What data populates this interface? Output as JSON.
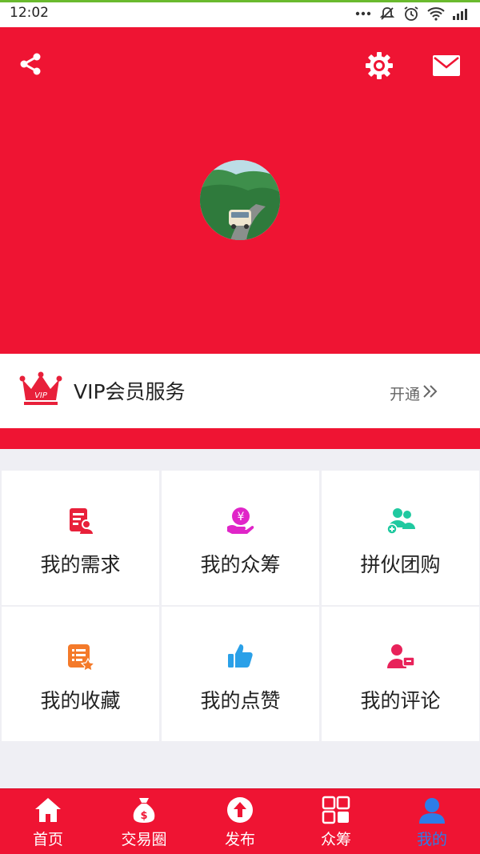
{
  "status_bar": {
    "time": "12:02",
    "icons": [
      "more-dots-icon",
      "mute-icon",
      "alarm-icon",
      "wifi-icon",
      "signal-icon"
    ]
  },
  "header": {
    "background_color": "#ef1433",
    "icons": [
      "share-icon",
      "settings-gear-icon",
      "mail-icon"
    ]
  },
  "vip": {
    "title": "VIP会员服务",
    "crown_text": "VIP",
    "action_label": "开通"
  },
  "menu": [
    {
      "label": "我的需求",
      "icon": "demand-doc-icon",
      "color": "#e8203a"
    },
    {
      "label": "我的众筹",
      "icon": "crowdfund-yen-icon",
      "color": "#e025c8"
    },
    {
      "label": "拼伙团购",
      "icon": "group-people-icon",
      "color": "#20c9a0"
    },
    {
      "label": "我的收藏",
      "icon": "favorites-list-icon",
      "color": "#f47a2a"
    },
    {
      "label": "我的点赞",
      "icon": "thumbs-up-icon",
      "color": "#2aa0e8"
    },
    {
      "label": "我的评论",
      "icon": "comment-user-icon",
      "color": "#e8225a"
    }
  ],
  "tabbar": {
    "items": [
      {
        "label": "首页",
        "icon": "home-icon"
      },
      {
        "label": "交易圈",
        "icon": "money-bag-icon"
      },
      {
        "label": "发布",
        "icon": "publish-upload-icon"
      },
      {
        "label": "众筹",
        "icon": "grid-apps-icon"
      },
      {
        "label": "我的",
        "icon": "user-profile-icon"
      }
    ],
    "active_index": 4,
    "active_color": "#2d7de8"
  }
}
